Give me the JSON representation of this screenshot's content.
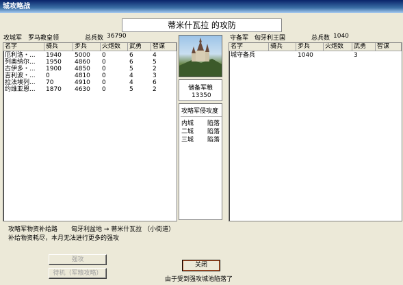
{
  "window": {
    "title": "城攻略战"
  },
  "banner": {
    "text": "蒂米什瓦拉 的攻防"
  },
  "attacker": {
    "side_label": "攻城军",
    "commander": "罗马教皇领",
    "total_label": "总兵数",
    "total_value": "36790",
    "columns": [
      "名字",
      "骑兵",
      "步兵",
      "火炮数",
      "武勇",
      "智谋"
    ],
    "rows": [
      [
        "厄利洛・...",
        "1940",
        "5000",
        "0",
        "6",
        "4"
      ],
      [
        "列奥纳尔...",
        "1950",
        "4860",
        "0",
        "6",
        "5"
      ],
      [
        "古伊多・...",
        "1900",
        "4850",
        "0",
        "5",
        "2"
      ],
      [
        "吉利波・...",
        "0",
        "4810",
        "0",
        "4",
        "3"
      ],
      [
        "拉法埃列...",
        "70",
        "4910",
        "0",
        "4",
        "6"
      ],
      [
        "约维亚恩...",
        "1870",
        "4630",
        "0",
        "5",
        "2"
      ]
    ]
  },
  "defender": {
    "side_label": "守备军",
    "commander": "匈牙利王国",
    "total_label": "总兵数",
    "total_value": "1040",
    "columns": [
      "名字",
      "骑兵",
      "步兵",
      "火炮数",
      "武勇",
      "智谋"
    ],
    "rows": [
      [
        "城守备兵",
        "",
        "1040",
        "",
        "3",
        ""
      ]
    ]
  },
  "center": {
    "reserve_label": "储备军粮",
    "reserve_value": "13350",
    "progress_title": "攻略军侵攻度",
    "progress": [
      {
        "area": "内城",
        "status": "陷落"
      },
      {
        "area": "二城",
        "status": "陷落"
      },
      {
        "area": "三城",
        "status": "陷落"
      }
    ]
  },
  "info": {
    "supply_label": "攻略军物资补给路",
    "supply_route": "匈牙利盆地 → 蒂米什瓦拉 （小街道）",
    "message": "补给物资耗尽，本月无法进行更多的强攻"
  },
  "buttons": {
    "assault": "强攻",
    "wait": "待机（军粮攻略）",
    "close": "关闭"
  },
  "status": {
    "text": "由于受到强攻城池陷落了"
  }
}
